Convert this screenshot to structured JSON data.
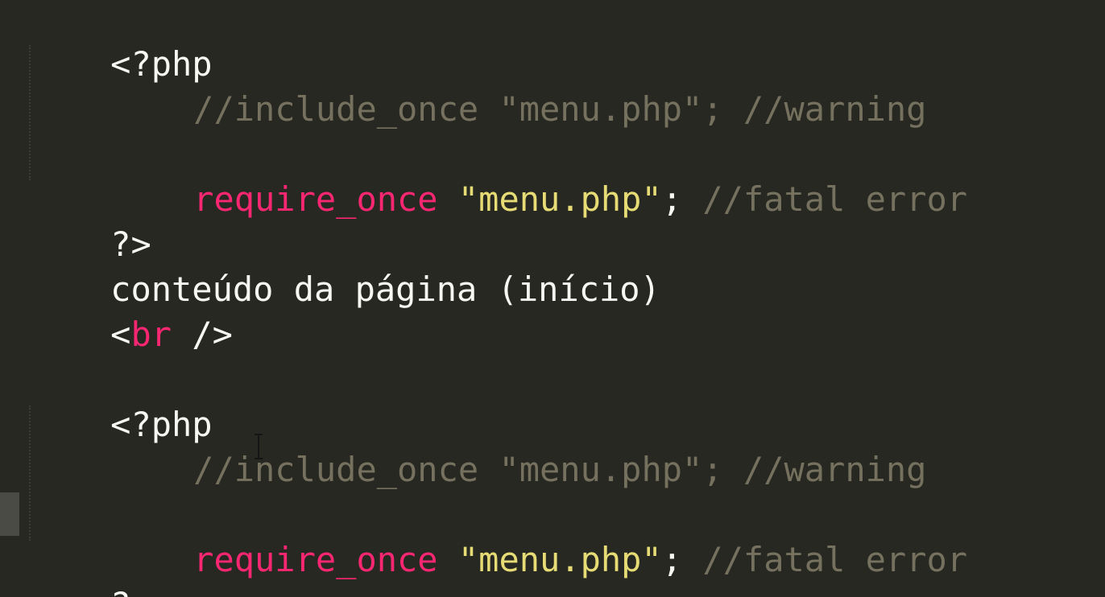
{
  "editor": {
    "theme_colors": {
      "background": "#272822",
      "plain": "#f8f8f2",
      "comment": "#75715e",
      "keyword": "#f92672",
      "string": "#e6db74"
    },
    "lines": [
      {
        "open_tag": "<?php"
      },
      {
        "comment_include": "//include_once \"menu.php\"; //warning"
      },
      {},
      {
        "keyword": "require_once",
        "space": " ",
        "string": "\"menu.php\"",
        "semicolon": ";",
        "comment": " //fatal error"
      },
      {
        "close_tag": "?>"
      },
      {
        "text": "conteúdo da página (início)"
      },
      {
        "lt": "<",
        "tag": "br",
        "rest": " />"
      },
      {},
      {
        "open_tag": "<?php"
      },
      {
        "comment_include": "//include_once \"menu.php\"; //warning"
      },
      {},
      {
        "keyword": "require_once",
        "space": " ",
        "string": "\"menu.php\"",
        "semicolon": ";",
        "comment": " //fatal error"
      },
      {
        "close_tag": "?>"
      }
    ],
    "cursor_icon": "text-cursor-icon"
  }
}
